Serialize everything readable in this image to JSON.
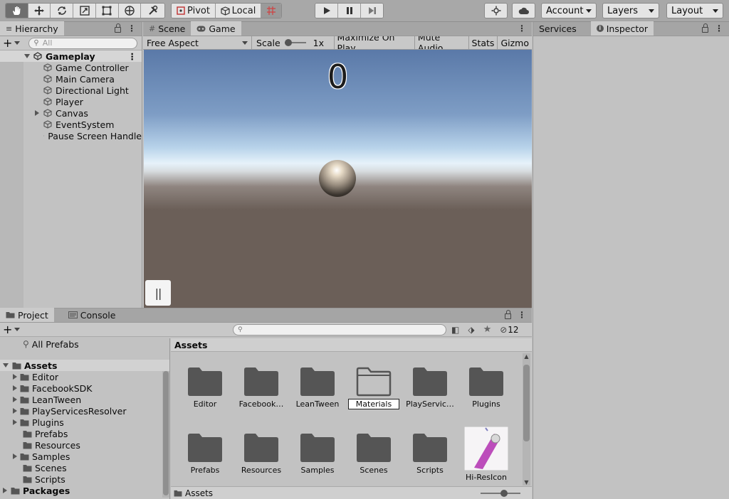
{
  "toolbar": {
    "pivot": "Pivot",
    "local": "Local",
    "account": "Account",
    "layers": "Layers",
    "layout": "Layout"
  },
  "hierarchy": {
    "tab": "Hierarchy",
    "search_placeholder": "All",
    "scene": "Gameplay",
    "items": [
      "Game Controller",
      "Main Camera",
      "Directional Light",
      "Player",
      "Canvas",
      "EventSystem",
      "Pause Screen Handle"
    ]
  },
  "center": {
    "tabs": [
      "Scene",
      "Game"
    ],
    "aspect": "Free Aspect",
    "scale_label": "Scale",
    "scale_value": "1x",
    "maximize": "Maximize On Play",
    "mute": "Mute Audio",
    "stats": "Stats",
    "gizmos": "Gizmo",
    "score": "0",
    "pause_glyph": "||"
  },
  "right": {
    "tabs": [
      "Services",
      "Inspector"
    ]
  },
  "project": {
    "tabs": [
      "Project",
      "Console"
    ],
    "hidden_count": "12",
    "all_prefabs": "All Prefabs",
    "assets_root": "Assets",
    "assets_children": [
      "Editor",
      "FacebookSDK",
      "LeanTween",
      "PlayServicesResolver",
      "Plugins",
      "Prefabs",
      "Resources",
      "Samples",
      "Scenes",
      "Scripts"
    ],
    "packages": "Packages",
    "grid_header": "Assets",
    "grid_row1": [
      "Editor",
      "Facebook…",
      "LeanTween",
      "Materials",
      "PlayServic…",
      "Plugins"
    ],
    "grid_row2": [
      "Prefabs",
      "Resources",
      "Samples",
      "Scenes",
      "Scripts",
      "Hi-ResIcon"
    ],
    "footer_path": "Assets"
  },
  "colors": {
    "accent": "#3a72b0",
    "sky_top": "#5a79a8",
    "horizon": "#e6f2fa",
    "ground": "#6b5f58"
  }
}
